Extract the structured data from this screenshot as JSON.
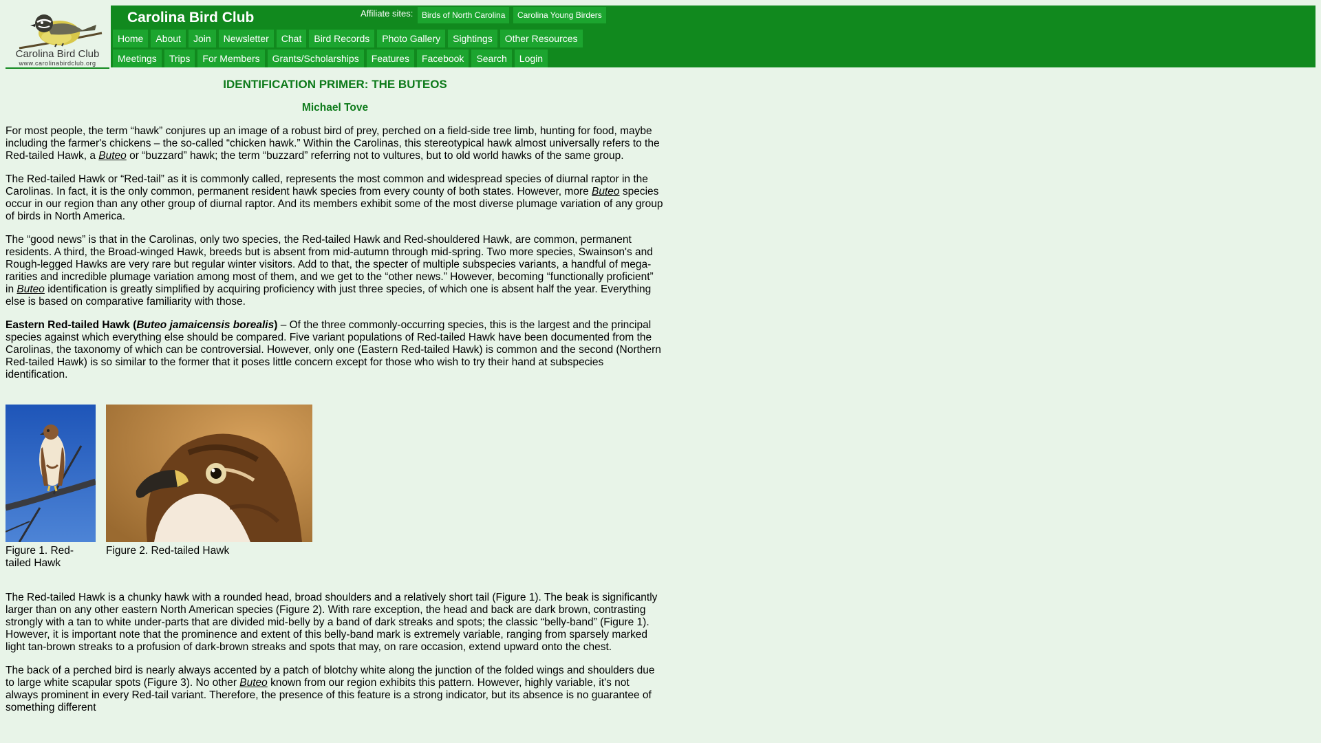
{
  "site": {
    "title": "Carolina Bird Club",
    "logo_text": "Carolina Bird Club",
    "logo_url_text": "www.carolinabirdclub.org"
  },
  "affiliate": {
    "label": "Affiliate sites:",
    "links": [
      "Birds of North Carolina",
      "Carolina Young Birders"
    ]
  },
  "nav": {
    "row1": [
      "Home",
      "About",
      "Join",
      "Newsletter",
      "Chat",
      "Bird Records",
      "Photo Gallery",
      "Sightings",
      "Other Resources"
    ],
    "row2": [
      "Meetings",
      "Trips",
      "For Members",
      "Grants/Scholarships",
      "Features",
      "Facebook",
      "Search",
      "Login"
    ]
  },
  "article": {
    "title": "IDENTIFICATION PRIMER: THE BUTEOS",
    "author": "Michael Tove",
    "genus": "Buteo",
    "p1a": "For most people, the term “hawk” conjures up an image of a robust bird of prey, perched on a field-side tree limb, hunting for food, maybe including the farmer's chickens – the so-called “chicken hawk.” Within the Carolinas, this stereotypical hawk almost universally refers to the Red-tailed Hawk, a ",
    "p1b": " or “buzzard” hawk; the term “buzzard” referring not to vultures, but to old world hawks of the same group.",
    "p2a": "The Red-tailed Hawk or “Red-tail” as it is commonly called, represents the most common and widespread species of diurnal raptor in the Carolinas. In fact, it is the only common, permanent resident hawk species from every county of both states. However, more ",
    "p2b": " species occur in our region than any other group of diurnal raptor. And its members exhibit some of the most diverse plumage variation of any group of birds in North America.",
    "p3a": "The “good news” is that in the Carolinas, only two species, the Red-tailed Hawk and Red-shouldered Hawk, are common, permanent residents. A third, the Broad-winged Hawk, breeds but is absent from mid-autumn through mid-spring. Two more species, Swainson's and Rough-legged Hawks are very rare but regular winter visitors. Add to that, the specter of multiple subspecies variants, a handful of mega-rarities and incredible plumage variation among most of them, and we get to the “other news.” However, becoming “functionally proficient” in ",
    "p3b": " identification is greatly simplified by acquiring proficiency with just three species, of which one is absent half the year. Everything else is based on comparative familiarity with those.",
    "p4_bold_a": "Eastern Red-tailed Hawk (",
    "p4_bold_italic": "Buteo jamaicensis borealis",
    "p4_bold_b": ")",
    "p4_rest": " – Of the three commonly-occurring species, this is the largest and the principal species against which everything else should be compared. Five variant populations of Red-tailed Hawk have been documented from the Carolinas, the taxonomy of which can be controversial. However, only one (Eastern Red-tailed Hawk) is common and the second (Northern Red-tailed Hawk) is so similar to the former that it poses little concern except for those who wish to try their hand at subspecies identification.",
    "fig1_caption": "Figure 1. Red-tailed Hawk",
    "fig2_caption": "Figure 2. Red-tailed Hawk",
    "p5": "The Red-tailed Hawk is a chunky hawk with a rounded head, broad shoulders and a relatively short tail (Figure 1). The beak is significantly larger than on any other eastern North American species (Figure 2). With rare exception, the head and back are dark brown, contrasting strongly with a tan to white under-parts that are divided mid-belly by a band of dark streaks and spots; the classic “belly-band” (Figure 1). However, it is important note that the prominence and extent of this belly-band mark is extremely variable, ranging from sparsely marked light tan-brown streaks to a profusion of dark-brown streaks and spots that may, on rare occasion, extend upward onto the chest.",
    "p6a": "The back of a perched bird is nearly always accented by a patch of blotchy white along the junction of the folded wings and shoulders due to large white scapular spots (Figure 3). No other ",
    "p6b": " known from our region exhibits this pattern. However, highly variable, it's not always prominent in every Red-tail variant. Therefore, the presence of this feature is a strong indicator, but its absence is no guarantee of something different"
  },
  "colors": {
    "header_green": "#11891e",
    "nav_green": "#1ca52f",
    "page_bg": "#e8f4e8",
    "title_green": "#0d7a1a"
  }
}
